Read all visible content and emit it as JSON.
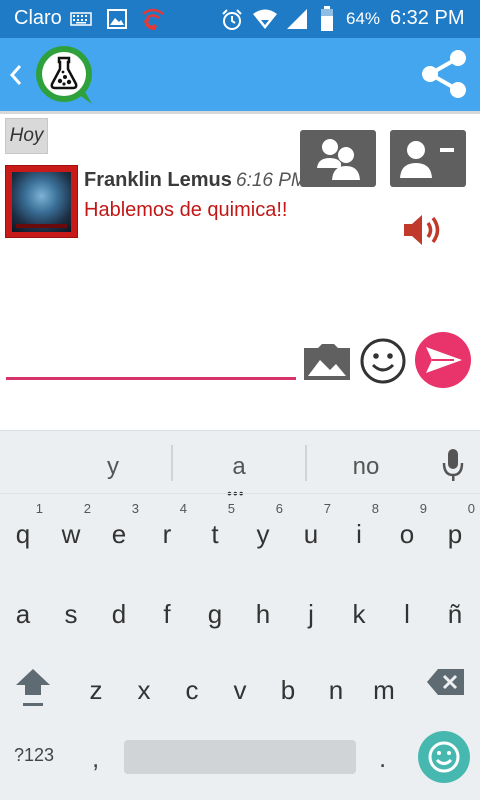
{
  "status_bar": {
    "carrier": "Claro",
    "battery": "64%",
    "time": "6:32 PM",
    "icons": [
      "keyboard-icon",
      "image-icon",
      "wifi-call-icon",
      "alarm-icon",
      "wifi-icon",
      "signal-icon",
      "battery-icon"
    ]
  },
  "app_bar": {
    "color": "#43a6ee",
    "icons": [
      "back-arrow-icon",
      "chemistry-flask-logo",
      "share-icon"
    ]
  },
  "chat": {
    "day_label": "Hoy",
    "messages": [
      {
        "sender": "Franklin Lemus",
        "time": "6:16 PM",
        "text": "Hablemos de quimica!!"
      }
    ],
    "message_color": "#c21717",
    "icons": [
      "group-icon",
      "contact-card-icon",
      "speaker-icon"
    ]
  },
  "composer": {
    "value": "",
    "placeholder": "",
    "accent_color": "#d6336c",
    "icons": [
      "gallery-icon",
      "smiley-icon",
      "send-icon"
    ]
  },
  "keyboard": {
    "suggestions": [
      "y",
      "a",
      "no"
    ],
    "row1": [
      {
        "k": "q",
        "n": "1"
      },
      {
        "k": "w",
        "n": "2"
      },
      {
        "k": "e",
        "n": "3"
      },
      {
        "k": "r",
        "n": "4"
      },
      {
        "k": "t",
        "n": "5"
      },
      {
        "k": "y",
        "n": "6"
      },
      {
        "k": "u",
        "n": "7"
      },
      {
        "k": "i",
        "n": "8"
      },
      {
        "k": "o",
        "n": "9"
      },
      {
        "k": "p",
        "n": "0"
      }
    ],
    "row2": [
      "a",
      "s",
      "d",
      "f",
      "g",
      "h",
      "j",
      "k",
      "l",
      "ñ"
    ],
    "row3": [
      "z",
      "x",
      "c",
      "v",
      "b",
      "n",
      "m"
    ],
    "symbols_label": "?123",
    "comma": ",",
    "period": ".",
    "icons": [
      "mic-icon",
      "shift-icon",
      "backspace-icon",
      "emoji-key-icon"
    ]
  }
}
